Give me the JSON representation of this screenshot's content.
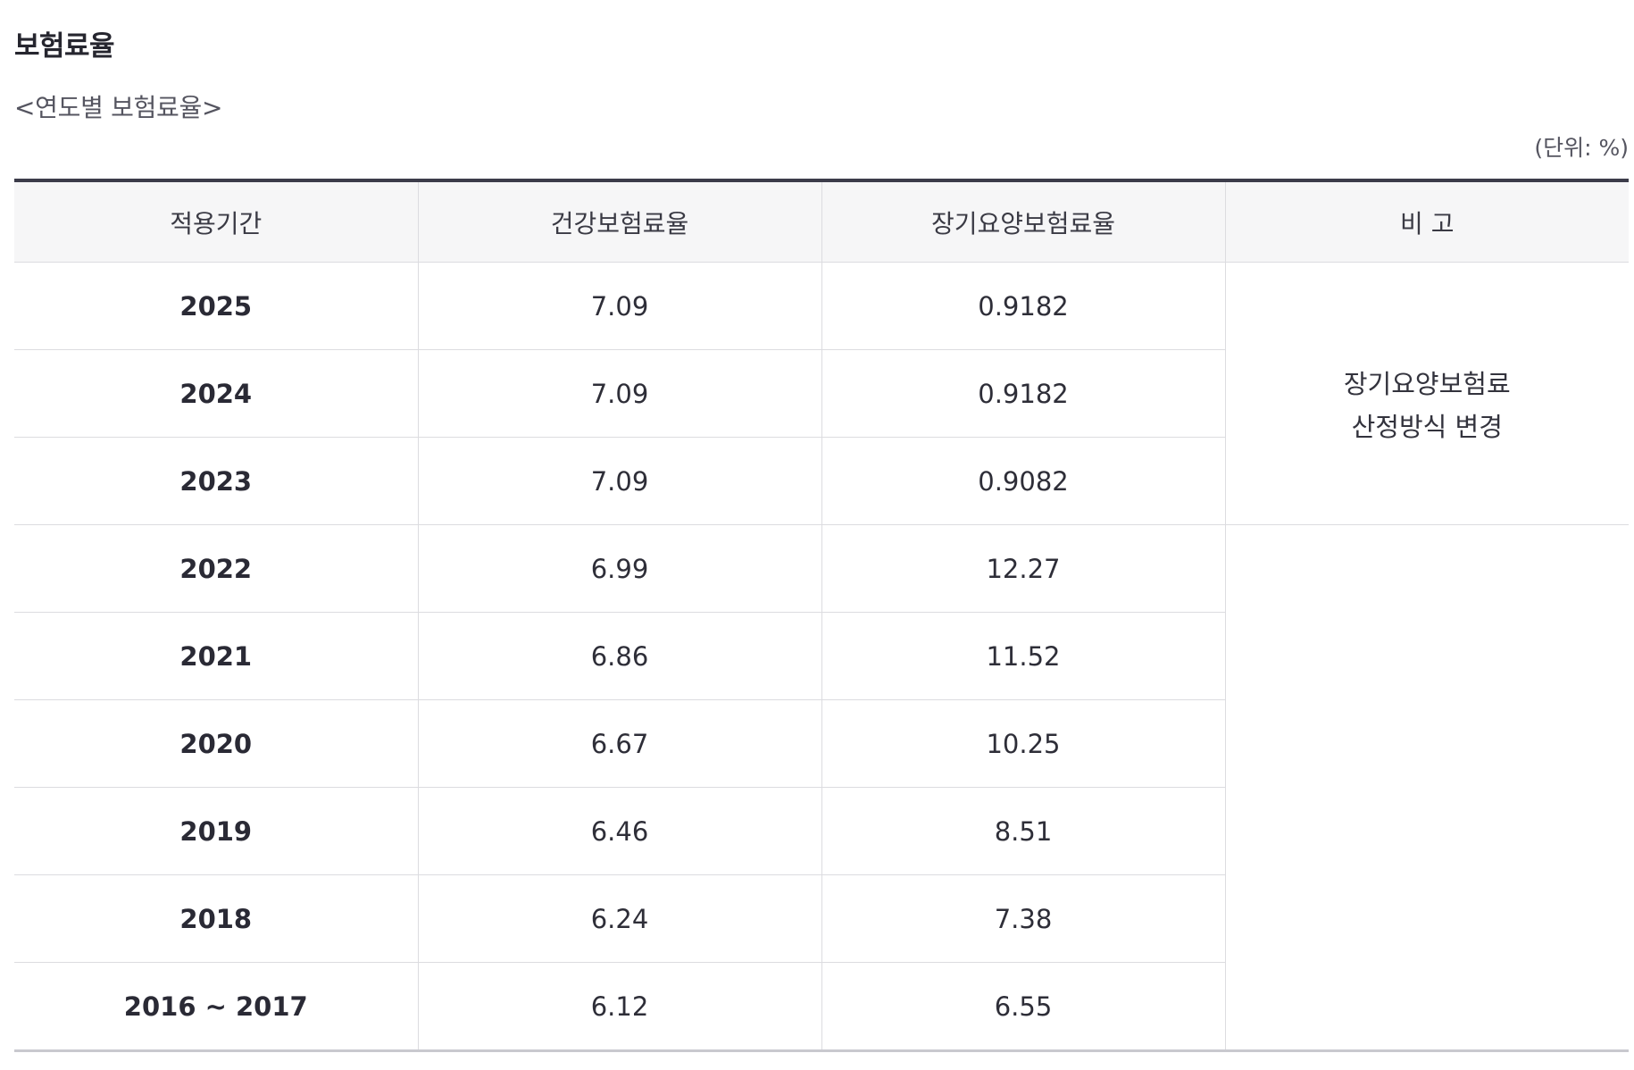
{
  "section_title": "보험료율",
  "table_caption": "<연도별 보험료율>",
  "unit_note": "(단위: %)",
  "table": {
    "headers": [
      "적용기간",
      "건강보험료율",
      "장기요양보험료율",
      "비 고"
    ],
    "rows": [
      {
        "period": "2025",
        "health_rate": "7.09",
        "ltc_rate": "0.9182"
      },
      {
        "period": "2024",
        "health_rate": "7.09",
        "ltc_rate": "0.9182"
      },
      {
        "period": "2023",
        "health_rate": "7.09",
        "ltc_rate": "0.9082"
      },
      {
        "period": "2022",
        "health_rate": "6.99",
        "ltc_rate": "12.27"
      },
      {
        "period": "2021",
        "health_rate": "6.86",
        "ltc_rate": "11.52"
      },
      {
        "period": "2020",
        "health_rate": "6.67",
        "ltc_rate": "10.25"
      },
      {
        "period": "2019",
        "health_rate": "6.46",
        "ltc_rate": "8.51"
      },
      {
        "period": "2018",
        "health_rate": "6.24",
        "ltc_rate": "7.38"
      },
      {
        "period": "2016 ~ 2017",
        "health_rate": "6.12",
        "ltc_rate": "6.55"
      }
    ],
    "note": {
      "line1": "장기요양보험료",
      "line2": "산정방식 변경"
    }
  }
}
